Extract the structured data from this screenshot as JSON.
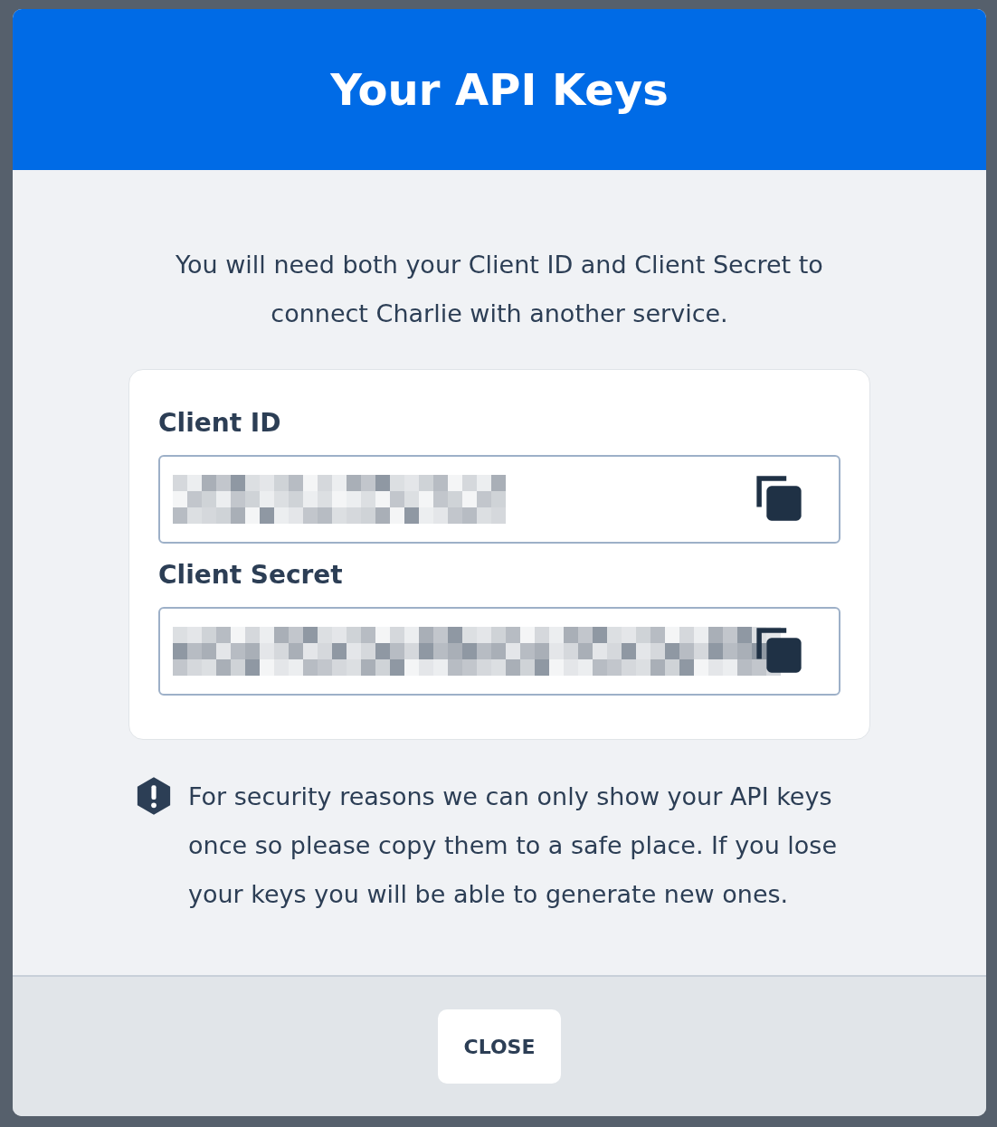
{
  "dialog": {
    "title": "Your API Keys",
    "intro": "You will need both your Client ID and Client Secret to connect Charlie with another service.",
    "fields": [
      {
        "label": "Client ID",
        "redacted": true
      },
      {
        "label": "Client Secret",
        "redacted": true
      }
    ],
    "warning": "For security reasons we can only show your API keys once so please copy them to a safe place. If you lose your keys you will be able to generate new ones.",
    "buttons": [
      {
        "label": "CLOSE"
      }
    ]
  }
}
